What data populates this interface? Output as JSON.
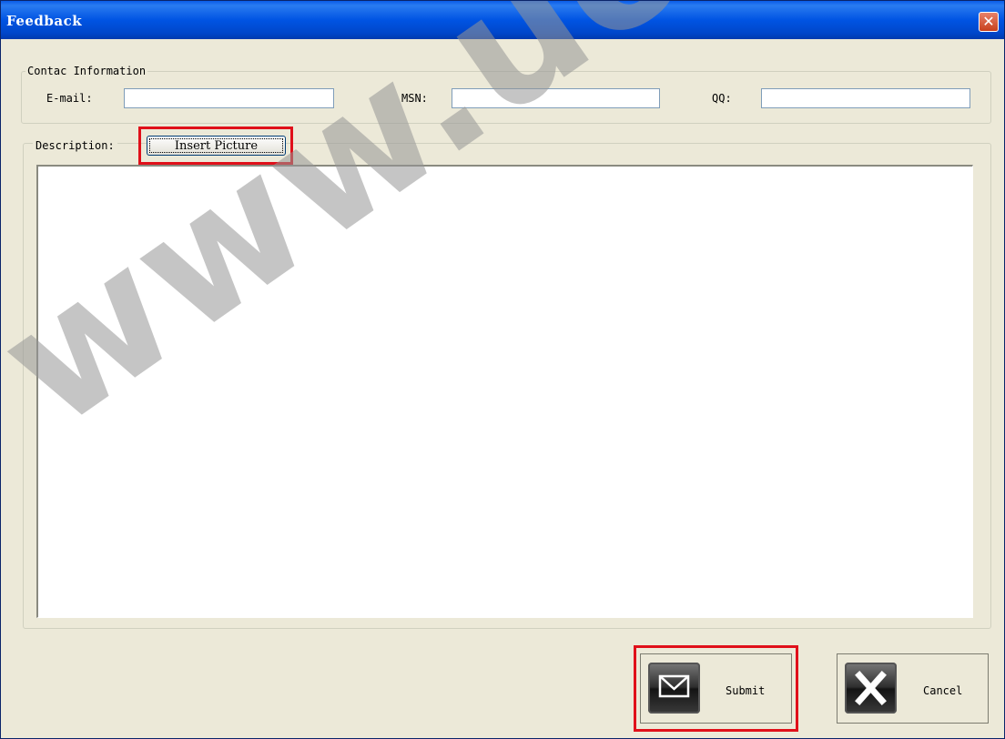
{
  "window": {
    "title": "Feedback",
    "close_glyph": "✕"
  },
  "contact": {
    "legend": "Contac Information",
    "email_label": "E-mail:",
    "email_value": "",
    "msn_label": "MSN:",
    "msn_value": "",
    "qq_label": "QQ:",
    "qq_value": ""
  },
  "description": {
    "legend": "Description:",
    "insert_picture_label": "Insert Picture",
    "text": ""
  },
  "actions": {
    "submit_label": "Submit",
    "submit_icon": "envelope-icon",
    "cancel_label": "Cancel",
    "cancel_icon": "x-icon"
  },
  "watermark": {
    "text": "www.uobdz.c"
  },
  "colors": {
    "titlebar": "#0054e3",
    "highlight": "#e0101a",
    "dialog_bg": "#ece9d8"
  }
}
